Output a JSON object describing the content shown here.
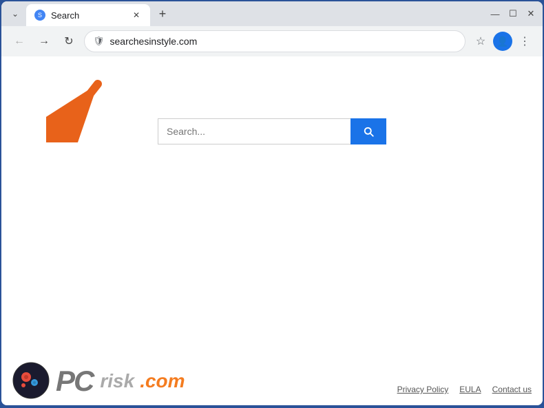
{
  "browser": {
    "tab": {
      "title": "Search",
      "favicon_label": "S"
    },
    "address": "searchesinstyle.com",
    "tab_new_label": "+",
    "controls": {
      "minimize": "—",
      "maximize": "☐",
      "close": "✕"
    },
    "nav": {
      "back_label": "←",
      "forward_label": "→",
      "reload_label": "↻",
      "dropdown_label": "⌄"
    },
    "icons": {
      "address_icon": "⊕",
      "star_label": "☆",
      "profile_label": "👤",
      "menu_label": "⋮"
    }
  },
  "page": {
    "search": {
      "placeholder": "Search...",
      "button_aria": "Search"
    }
  },
  "footer": {
    "brand_text_pc": "PC",
    "brand_text_risk": "risk",
    "brand_text_com": ".com",
    "links": [
      {
        "label": "Privacy Policy"
      },
      {
        "label": "EULA"
      },
      {
        "label": "Contact us"
      }
    ]
  }
}
